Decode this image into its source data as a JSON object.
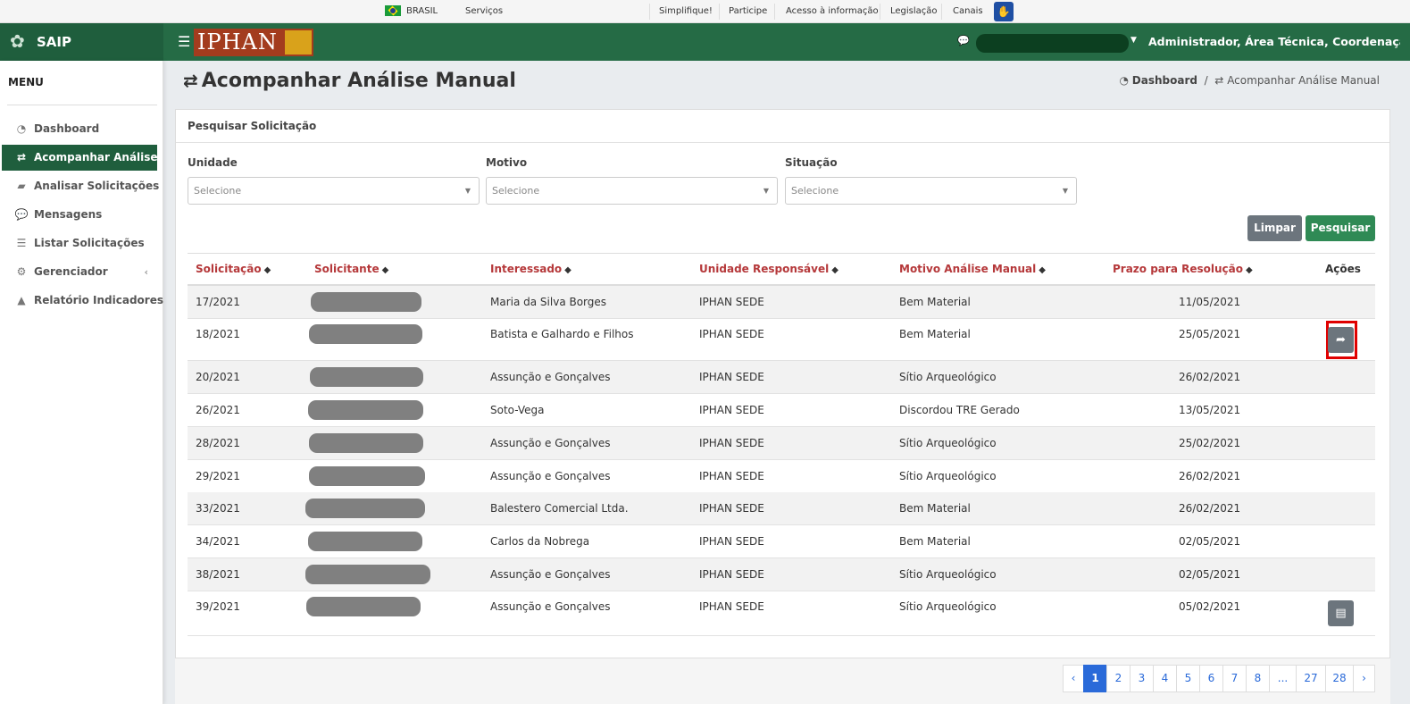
{
  "govbar": {
    "country": "BRASIL",
    "services": "Serviços",
    "links": [
      "Simplifique!",
      "Participe",
      "Acesso à informação",
      "Legislação",
      "Canais"
    ]
  },
  "app": {
    "name": "SAIP",
    "logo_text": "IPHAN",
    "user_role": "Administrador, Área Técnica, Coordenação Técnica"
  },
  "sidebar": {
    "title": "MENU",
    "items": [
      {
        "label": "Dashboard",
        "icon": "dashboard-icon"
      },
      {
        "label": "Acompanhar Análise",
        "icon": "exchange-icon"
      },
      {
        "label": "Analisar Solicitações",
        "icon": "book-icon"
      },
      {
        "label": "Mensagens",
        "icon": "comments-icon"
      },
      {
        "label": "Listar Solicitações",
        "icon": "list-icon"
      },
      {
        "label": "Gerenciador",
        "icon": "cogs-icon"
      },
      {
        "label": "Relatório Indicadores",
        "icon": "area-chart-icon"
      }
    ]
  },
  "page": {
    "title": "Acompanhar Análise Manual",
    "breadcrumb": [
      "Dashboard",
      "Acompanhar Análise Manual"
    ]
  },
  "search": {
    "title": "Pesquisar Solicitação",
    "fields": [
      {
        "label": "Unidade",
        "placeholder": "Selecione"
      },
      {
        "label": "Motivo",
        "placeholder": "Selecione"
      },
      {
        "label": "Situação",
        "placeholder": "Selecione"
      }
    ],
    "clear_label": "Limpar",
    "search_label": "Pesquisar"
  },
  "table": {
    "columns": [
      "Solicitação",
      "Solicitante",
      "Interessado",
      "Unidade Responsável",
      "Motivo Análise Manual",
      "Prazo para Resolução",
      "Ações"
    ],
    "rows": [
      {
        "solicitacao": "17/2021",
        "interessado": "Maria da Silva Borges",
        "unidade": "IPHAN SEDE",
        "motivo": "Bem Material",
        "prazo": "11/05/2021",
        "action": ""
      },
      {
        "solicitacao": "18/2021",
        "interessado": "Batista e Galhardo e Filhos",
        "unidade": "IPHAN SEDE",
        "motivo": "Bem Material",
        "prazo": "25/05/2021",
        "action": "share-icon"
      },
      {
        "solicitacao": "20/2021",
        "interessado": "Assunção e Gonçalves",
        "unidade": "IPHAN SEDE",
        "motivo": "Sítio Arqueológico",
        "prazo": "26/02/2021",
        "action": ""
      },
      {
        "solicitacao": "26/2021",
        "interessado": "Soto-Vega",
        "unidade": "IPHAN SEDE",
        "motivo": "Discordou TRE Gerado",
        "prazo": "13/05/2021",
        "action": ""
      },
      {
        "solicitacao": "28/2021",
        "interessado": "Assunção e Gonçalves",
        "unidade": "IPHAN SEDE",
        "motivo": "Sítio Arqueológico",
        "prazo": "25/02/2021",
        "action": ""
      },
      {
        "solicitacao": "29/2021",
        "interessado": "Assunção e Gonçalves",
        "unidade": "IPHAN SEDE",
        "motivo": "Sítio Arqueológico",
        "prazo": "26/02/2021",
        "action": ""
      },
      {
        "solicitacao": "33/2021",
        "interessado": "Balestero Comercial Ltda.",
        "unidade": "IPHAN SEDE",
        "motivo": "Bem Material",
        "prazo": "26/02/2021",
        "action": ""
      },
      {
        "solicitacao": "34/2021",
        "interessado": "Carlos da Nobrega",
        "unidade": "IPHAN SEDE",
        "motivo": "Bem Material",
        "prazo": "02/05/2021",
        "action": ""
      },
      {
        "solicitacao": "38/2021",
        "interessado": "Assunção e Gonçalves",
        "unidade": "IPHAN SEDE",
        "motivo": "Sítio Arqueológico",
        "prazo": "02/05/2021",
        "action": ""
      },
      {
        "solicitacao": "39/2021",
        "interessado": "Assunção e Gonçalves",
        "unidade": "IPHAN SEDE",
        "motivo": "Sítio Arqueológico",
        "prazo": "05/02/2021",
        "action": "file-icon"
      }
    ]
  },
  "pagination": {
    "items": [
      "‹",
      "1",
      "2",
      "3",
      "4",
      "5",
      "6",
      "7",
      "8",
      "...",
      "27",
      "28",
      "›"
    ],
    "current": "1"
  },
  "colors": {
    "brand_green": "#1f5e3d",
    "header_green": "#256b45",
    "sort_red": "#b5383a",
    "primary_blue": "#2a6ad9",
    "highlight_red": "#e00000"
  }
}
